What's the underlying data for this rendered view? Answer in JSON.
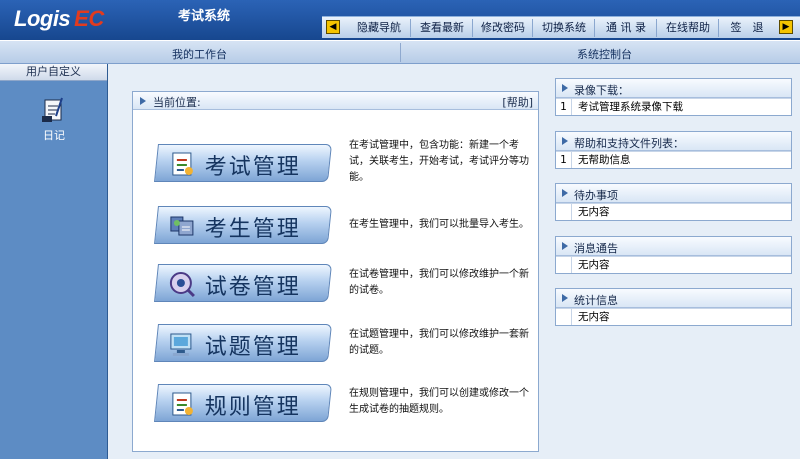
{
  "app": {
    "logo_text": "Logis",
    "logo_accent": "EC",
    "system_name": "考试系统"
  },
  "nav": {
    "items": [
      "隐藏导航",
      "查看最新",
      "修改密码",
      "切换系统",
      "通 讯 录",
      "在线帮助",
      "签　退"
    ]
  },
  "subbar": {
    "left_label": "我的工作台",
    "right_label": "系统控制台"
  },
  "sidebar": {
    "header": "用户自定义",
    "diary_label": "日记"
  },
  "main": {
    "location_label": "当前位置:",
    "help_label": "[帮助]",
    "modules": [
      {
        "title": "考试管理",
        "icon": "exam-icon",
        "desc": "在考试管理中，包含功能：新建一个考试，关联考生，开始考试，考试评分等功能。"
      },
      {
        "title": "考生管理",
        "icon": "students-icon",
        "desc": "在考生管理中，我们可以批量导入考生。"
      },
      {
        "title": "试卷管理",
        "icon": "paper-icon",
        "desc": "在试卷管理中，我们可以修改维护一个新的试卷。"
      },
      {
        "title": "试题管理",
        "icon": "question-icon",
        "desc": "在试题管理中，我们可以修改维护一套新的试题。"
      },
      {
        "title": "规则管理",
        "icon": "rules-icon",
        "desc": "在规则管理中，我们可以创建或修改一个生成试卷的抽题规则。"
      }
    ]
  },
  "panels": [
    {
      "title": "录像下载：",
      "rows": [
        {
          "num": "1",
          "text": "考试管理系统录像下载"
        }
      ]
    },
    {
      "title": "帮助和支持文件列表：",
      "rows": [
        {
          "num": "1",
          "text": "无帮助信息"
        }
      ]
    },
    {
      "title": "待办事项",
      "rows": [
        {
          "num": "",
          "text": "无内容"
        }
      ]
    },
    {
      "title": "消息通告",
      "rows": [
        {
          "num": "",
          "text": "无内容"
        }
      ]
    },
    {
      "title": "统计信息",
      "rows": [
        {
          "num": "",
          "text": "无内容"
        }
      ]
    }
  ],
  "colors": {
    "accent": "#1f55a6",
    "logo_accent": "#e23b1f",
    "nav_arrow": "#f5c400"
  }
}
